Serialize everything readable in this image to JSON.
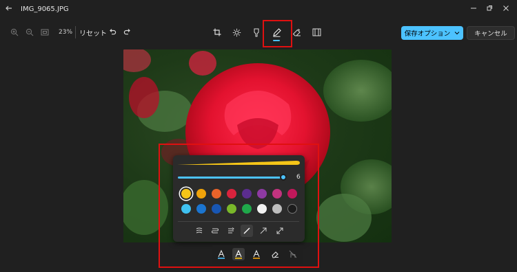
{
  "window": {
    "title": "IMG_9065.JPG"
  },
  "toolbar": {
    "zoom_level": "23%",
    "reset_label": "リセット"
  },
  "actions": {
    "save_label": "保存オプション",
    "cancel_label": "キャンセル"
  },
  "pen_settings": {
    "thickness": 6,
    "thickness_label": "6",
    "thickness_fraction": 0.97,
    "colors_row1": [
      "#f5c518",
      "#f0a30a",
      "#e8632a",
      "#d9233d",
      "#5b2d8e",
      "#8e3aa3",
      "#c2337f",
      "#c2185b"
    ],
    "colors_row2": [
      "#3fc1f0",
      "#1b75d0",
      "#1856b3",
      "#7ab82a",
      "#1fa84a",
      "#f2f2f2",
      "#bdbdbd",
      "#1c1c1c"
    ],
    "selected_color": "#f5c518"
  },
  "colors": {
    "accent": "#4cc2ff",
    "highlight_box": "#e01010"
  }
}
